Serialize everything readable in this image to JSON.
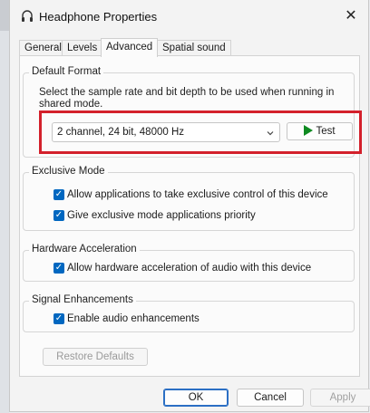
{
  "window": {
    "title": "Headphone Properties",
    "close_glyph": "✕",
    "app_icon": "headphones-icon"
  },
  "tabs": [
    {
      "label": "General",
      "active": false
    },
    {
      "label": "Levels",
      "active": false
    },
    {
      "label": "Advanced",
      "active": true
    },
    {
      "label": "Spatial sound",
      "active": false
    }
  ],
  "default_format": {
    "heading": "Default Format",
    "description": "Select the sample rate and bit depth to be used when running in shared mode.",
    "selected_value": "2 channel, 24 bit, 48000 Hz",
    "test_label": "Test"
  },
  "exclusive_mode": {
    "heading": "Exclusive Mode",
    "options": [
      {
        "label": "Allow applications to take exclusive control of this device",
        "checked": true
      },
      {
        "label": "Give exclusive mode applications priority",
        "checked": true
      }
    ]
  },
  "hardware_acceleration": {
    "heading": "Hardware Acceleration",
    "options": [
      {
        "label": "Allow hardware acceleration of audio with this device",
        "checked": true
      }
    ]
  },
  "signal_enhancements": {
    "heading": "Signal Enhancements",
    "options": [
      {
        "label": "Enable audio enhancements",
        "checked": true
      }
    ]
  },
  "restore_defaults_label": "Restore Defaults",
  "footer": {
    "ok_label": "OK",
    "cancel_label": "Cancel",
    "apply_label": "Apply"
  },
  "colors": {
    "accent": "#0067c0",
    "highlight": "#d3202b",
    "play": "#0f8a21"
  },
  "checkmark_glyph": "✓"
}
